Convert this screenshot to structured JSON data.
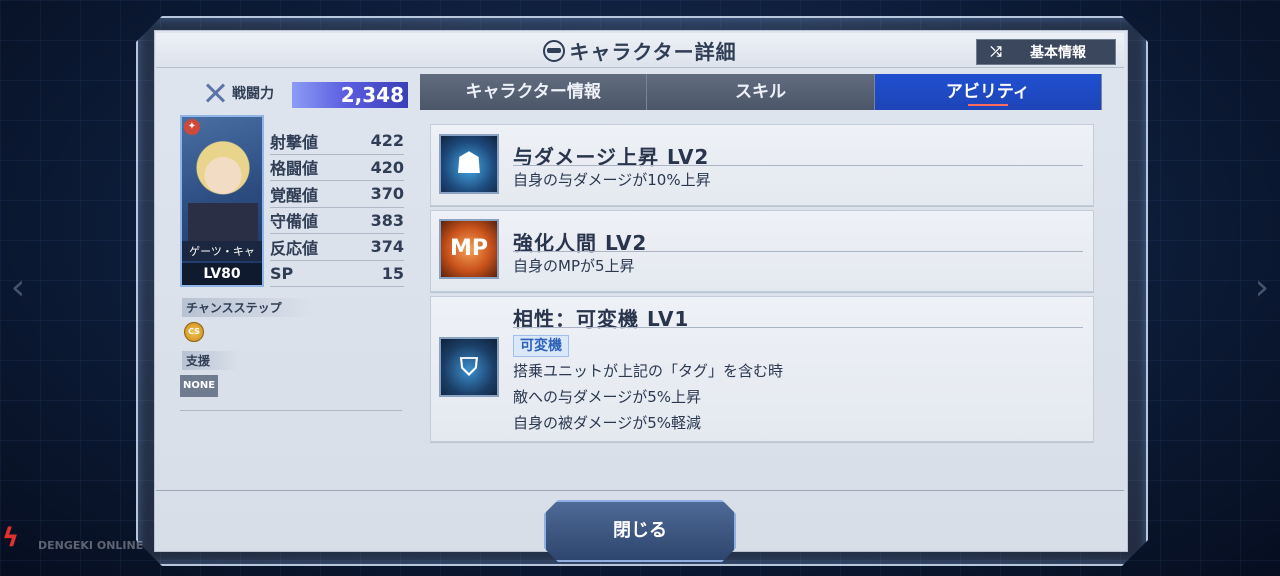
{
  "header": {
    "title": "キャラクター詳細",
    "info_button_label": "基本情報"
  },
  "left": {
    "power_label": "戦闘力",
    "power_value": "2,348",
    "card": {
      "name": "ゲーツ・キャ",
      "level": "LV80"
    },
    "stats": [
      {
        "label": "射撃値",
        "value": "422"
      },
      {
        "label": "格闘値",
        "value": "420"
      },
      {
        "label": "覚醒値",
        "value": "370"
      },
      {
        "label": "守備値",
        "value": "383"
      },
      {
        "label": "反応値",
        "value": "374"
      },
      {
        "label": "SP",
        "value": "15"
      }
    ],
    "chance_step_label": "チャンスステップ",
    "chance_step_icon": "CS",
    "support_label": "支援",
    "support_value": "NONE"
  },
  "tabs": [
    {
      "label": "キャラクター情報",
      "active": false
    },
    {
      "label": "スキル",
      "active": false
    },
    {
      "label": "アビリティ",
      "active": true
    }
  ],
  "abilities": [
    {
      "icon": "pilot-damage-up-icon",
      "title": "与ダメージ上昇 LV2",
      "lines": [
        "自身の与ダメージが10%上昇"
      ]
    },
    {
      "icon": "mp-icon",
      "icon_text": "MP",
      "title": "強化人間 LV2",
      "lines": [
        "自身のMPが5上昇"
      ]
    },
    {
      "icon": "affinity-unit-icon",
      "title": "相性：可変機 LV1",
      "tag": "可変機",
      "lines": [
        "搭乗ユニットが上記の「タグ」を含む時",
        "敵への与ダメージが5%上昇",
        "自身の被ダメージが5%軽減"
      ]
    }
  ],
  "footer": {
    "close_label": "閉じる"
  },
  "watermark": {
    "text": "DENGEKI ONLINE"
  }
}
